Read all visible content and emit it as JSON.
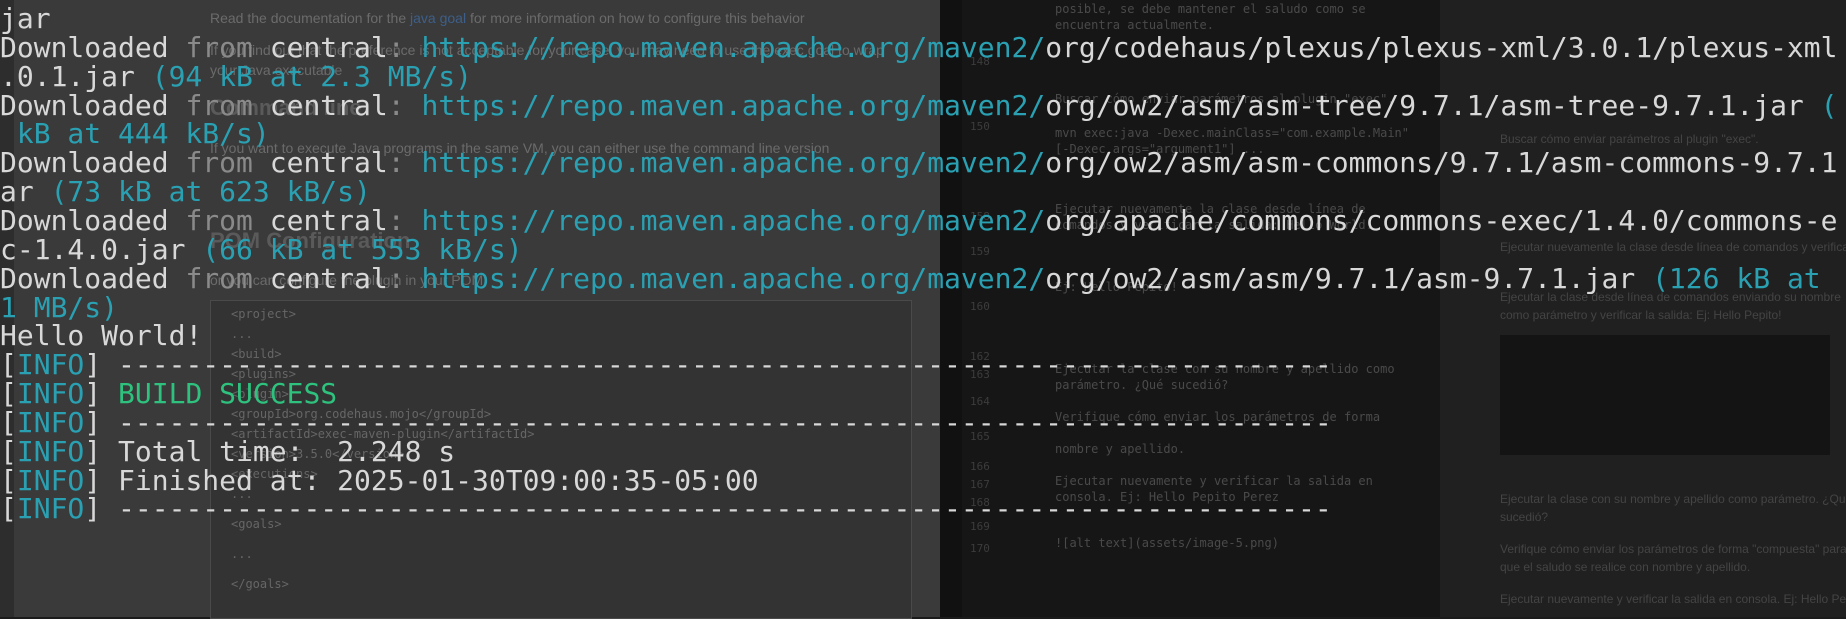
{
  "terminal": {
    "lines": [
      {
        "id": "l0",
        "segments": [
          {
            "t": "jar",
            "c": "w"
          }
        ]
      },
      {
        "id": "l1",
        "segments": [
          {
            "t": "Downloaded ",
            "c": "w"
          },
          {
            "t": "from ",
            "c": "g"
          },
          {
            "t": "central",
            "c": "w"
          },
          {
            "t": ": ",
            "c": "g"
          },
          {
            "t": "https://repo.maven.apache.org/maven2/",
            "c": "c"
          },
          {
            "t": "org/codehaus/plexus/plexus-xml/3.0.1/plexus-xml",
            "c": "w"
          }
        ]
      },
      {
        "id": "l2",
        "segments": [
          {
            "t": ".0.1.jar ",
            "c": "w"
          },
          {
            "t": "(94 kB at 2.3 MB/s)",
            "c": "c"
          }
        ]
      },
      {
        "id": "l3",
        "segments": [
          {
            "t": "Downloaded ",
            "c": "w"
          },
          {
            "t": "from ",
            "c": "g"
          },
          {
            "t": "central",
            "c": "w"
          },
          {
            "t": ": ",
            "c": "g"
          },
          {
            "t": "https://repo.maven.apache.org/maven2/",
            "c": "c"
          },
          {
            "t": "org/ow2/asm/asm-tree/9.7.1/asm-tree-9.7.1.jar ",
            "c": "w"
          },
          {
            "t": "(",
            "c": "c"
          }
        ]
      },
      {
        "id": "l4",
        "segments": [
          {
            "t": " kB at 444 kB/s)",
            "c": "c"
          }
        ]
      },
      {
        "id": "l5",
        "segments": [
          {
            "t": "Downloaded ",
            "c": "w"
          },
          {
            "t": "from ",
            "c": "g"
          },
          {
            "t": "central",
            "c": "w"
          },
          {
            "t": ": ",
            "c": "g"
          },
          {
            "t": "https://repo.maven.apache.org/maven2/",
            "c": "c"
          },
          {
            "t": "org/ow2/asm/asm-commons/9.7.1/asm-commons-9.7.1",
            "c": "w"
          }
        ]
      },
      {
        "id": "l6",
        "segments": [
          {
            "t": "ar ",
            "c": "w"
          },
          {
            "t": "(73 kB at 623 kB/s)",
            "c": "c"
          }
        ]
      },
      {
        "id": "l7",
        "segments": [
          {
            "t": "Downloaded ",
            "c": "w"
          },
          {
            "t": "from ",
            "c": "g"
          },
          {
            "t": "central",
            "c": "w"
          },
          {
            "t": ": ",
            "c": "g"
          },
          {
            "t": "https://repo.maven.apache.org/maven2/",
            "c": "c"
          },
          {
            "t": "org/apache/commons/commons-exec/1.4.0/commons-e",
            "c": "w"
          }
        ]
      },
      {
        "id": "l8",
        "segments": [
          {
            "t": "c-1.4.0.jar ",
            "c": "w"
          },
          {
            "t": "(66 kB at 553 kB/s)",
            "c": "c"
          }
        ]
      },
      {
        "id": "l9",
        "segments": [
          {
            "t": "Downloaded ",
            "c": "w"
          },
          {
            "t": "from ",
            "c": "g"
          },
          {
            "t": "central",
            "c": "w"
          },
          {
            "t": ": ",
            "c": "g"
          },
          {
            "t": "https://repo.maven.apache.org/maven2/",
            "c": "c"
          },
          {
            "t": "org/ow2/asm/asm/9.7.1/asm-9.7.1.jar ",
            "c": "w"
          },
          {
            "t": "(126 kB at",
            "c": "c"
          }
        ]
      },
      {
        "id": "l10",
        "segments": [
          {
            "t": "1 MB/s)",
            "c": "c"
          }
        ]
      },
      {
        "id": "l11",
        "segments": [
          {
            "t": "Hello World!",
            "c": "w"
          }
        ]
      },
      {
        "id": "l12",
        "segments": [
          {
            "t": "[",
            "c": "w"
          },
          {
            "t": "INFO",
            "c": "c"
          },
          {
            "t": "] ------------------------------------------------------------------------",
            "c": "w"
          }
        ]
      },
      {
        "id": "l13",
        "segments": [
          {
            "t": "[",
            "c": "w"
          },
          {
            "t": "INFO",
            "c": "c"
          },
          {
            "t": "] ",
            "c": "w"
          },
          {
            "t": "BUILD SUCCESS",
            "c": "ok"
          }
        ]
      },
      {
        "id": "l14",
        "segments": [
          {
            "t": "[",
            "c": "w"
          },
          {
            "t": "INFO",
            "c": "c"
          },
          {
            "t": "] ------------------------------------------------------------------------",
            "c": "w"
          }
        ]
      },
      {
        "id": "l15",
        "segments": [
          {
            "t": "[",
            "c": "w"
          },
          {
            "t": "INFO",
            "c": "c"
          },
          {
            "t": "] Total time:  2.248 s",
            "c": "w"
          }
        ]
      },
      {
        "id": "l16",
        "segments": [
          {
            "t": "[",
            "c": "w"
          },
          {
            "t": "INFO",
            "c": "c"
          },
          {
            "t": "] Finished at: 2025-01-30T09:00:35-05:00",
            "c": "w"
          }
        ]
      },
      {
        "id": "l17",
        "segments": [
          {
            "t": "[",
            "c": "w"
          },
          {
            "t": "INFO",
            "c": "c"
          },
          {
            "t": "] ------------------------------------------------------------------------",
            "c": "w"
          }
        ]
      }
    ]
  },
  "background_doc": {
    "intro": "Read the documentation for the ",
    "intro_link": "java goal",
    "intro_tail": " for more information on how to configure this behavior",
    "para2": "If you find out that the preference is not acceptable for your case, you may need to use the exec goal to wrap",
    "para2b": "your Java executable",
    "h_cmd": "Command line",
    "cmd_text": "If you want to execute Java programs in the same VM, you can either use the command line version",
    "h_pom": "POM Configuration",
    "pom_text": "or you can configure the plugin in your POM:",
    "code": [
      "<project>",
      "  ...",
      "  <build>",
      "    <plugins>",
      "      <plugin>",
      "        <groupId>org.codehaus.mojo</groupId>",
      "        <artifactId>exec-maven-plugin</artifactId>",
      "        <version>3.5.0</version>",
      "        <executions>",
      "          ...",
      "          <goals>",
      "          ...",
      "          </goals>"
    ]
  },
  "background_editor": {
    "lines": [
      {
        "n": "",
        "t": "posible, se debe mantener el saludo como se"
      },
      {
        "n": "",
        "t": "encuentra actualmente."
      },
      {
        "n": "",
        "t": "Buscar cómo enviar parámetros al plugin \"exec\"."
      },
      {
        "n": "",
        "t": "mvn exec:java -Dexec.mainClass=\"com.example.Main\""
      },
      {
        "n": "",
        "t": "[-Dexec.args=\"argument1\"] ..."
      },
      {
        "n": "",
        "t": "Ejecutar nuevamente la clase desde línea de"
      },
      {
        "n": "",
        "t": "comandos y verificar la salida: Hello World!"
      },
      {
        "n": "",
        "t": "Ej: Hello Pepito!"
      },
      {
        "n": "",
        "t": "Ejecutar la clase con su nombre y apellido como"
      },
      {
        "n": "",
        "t": "parámetro. ¿Qué sucedió?"
      },
      {
        "n": "",
        "t": "Verifique cómo enviar los parámetros de forma"
      },
      {
        "n": "",
        "t": "nombre y apellido."
      },
      {
        "n": "",
        "t": "Ejecutar nuevamente y verificar la salida en"
      },
      {
        "n": "",
        "t": "consola. Ej: Hello Pepito Perez"
      },
      {
        "n": "",
        "t": "![alt text](assets/image-5.png)"
      }
    ],
    "gutter": [
      "148",
      "150",
      "158",
      "159",
      "160",
      "162",
      "163",
      "164",
      "165",
      "166",
      "167",
      "168",
      "169",
      "170",
      "171"
    ]
  },
  "background_preview": {
    "p1": "Buscar cómo enviar parámetros al plugin \"exec\".",
    "p2": "Ejecutar nuevamente la clase desde línea de comandos y verificar la",
    "p3": "Ejecutar la clase desde línea de comandos enviando su nombre",
    "p4": "como parámetro y verificar la salida: Ej: Hello Pepito!",
    "p5": "Ejecutar la clase con su nombre y apellido como parámetro. ¿Qué",
    "p6": "sucedió?",
    "p7": "Verifique cómo enviar los parámetros de forma \"compuesta\" para",
    "p8": "que el saludo se realice con nombre y apellido.",
    "p9": "Ejecutar nuevamente y verificar la salida en consola. Ej: Hello Pepito"
  }
}
